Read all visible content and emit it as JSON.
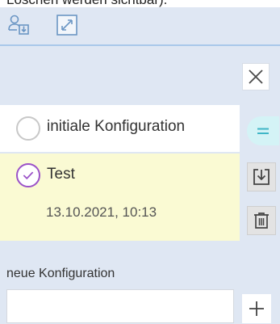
{
  "caption": "Löschen werden sichtbar).",
  "toolbar": {
    "tools": [
      {
        "icon": "user-load-icon"
      },
      {
        "icon": "expand-icon"
      }
    ]
  },
  "configurations": [
    {
      "name": "initiale Konfiguration",
      "selected": false
    },
    {
      "name": "Test",
      "date": "13.10.2021, 10:13",
      "selected": true
    }
  ],
  "new_config": {
    "label": "neue Konfiguration",
    "value": "",
    "placeholder": ""
  },
  "colors": {
    "panel_bg": "#dfe7f3",
    "selected_bg": "#fafad3",
    "selected_radio": "#9b52c8",
    "equal_button_bg": "#d4f3f6",
    "toolbar_icon": "#6b96c4"
  }
}
